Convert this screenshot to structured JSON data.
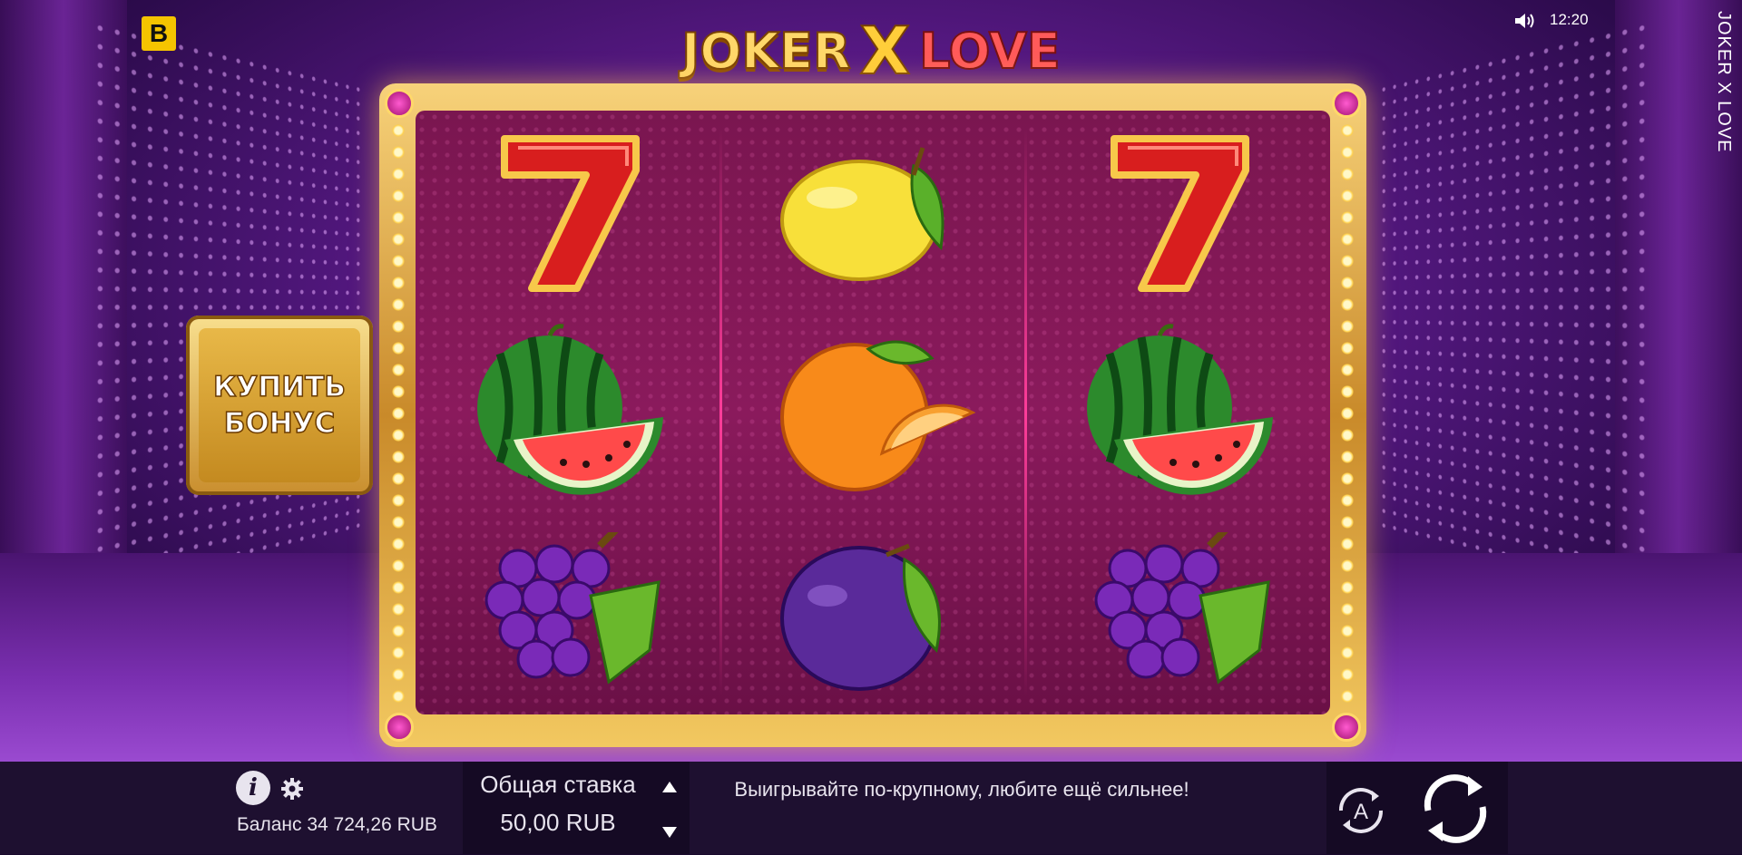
{
  "brand": {
    "logo": "B"
  },
  "status": {
    "time": "12:20",
    "sound_icon": "speaker-icon"
  },
  "game": {
    "title_parts": {
      "joker": "JOKER",
      "x": "X",
      "love": "LOVE"
    },
    "side_title": "JOKER X LOVE"
  },
  "reels": [
    [
      "seven",
      "watermelon",
      "grapes"
    ],
    [
      "lemon",
      "orange",
      "plum"
    ],
    [
      "seven",
      "watermelon",
      "grapes"
    ]
  ],
  "buy_bonus": {
    "line1": "КУПИТЬ",
    "line2": "БОНУС"
  },
  "bottom_bar": {
    "balance": "Баланс 34 724,26 RUB",
    "bet_label": "Общая ставка",
    "bet_value": "50,00 RUB",
    "tagline": "Выигрывайте по-крупному, любите ещё сильнее!",
    "auto_label": "A"
  },
  "colors": {
    "gold": "#f2c860",
    "reel_bg": "#7a1650",
    "bar_bg": "#1e1030"
  }
}
